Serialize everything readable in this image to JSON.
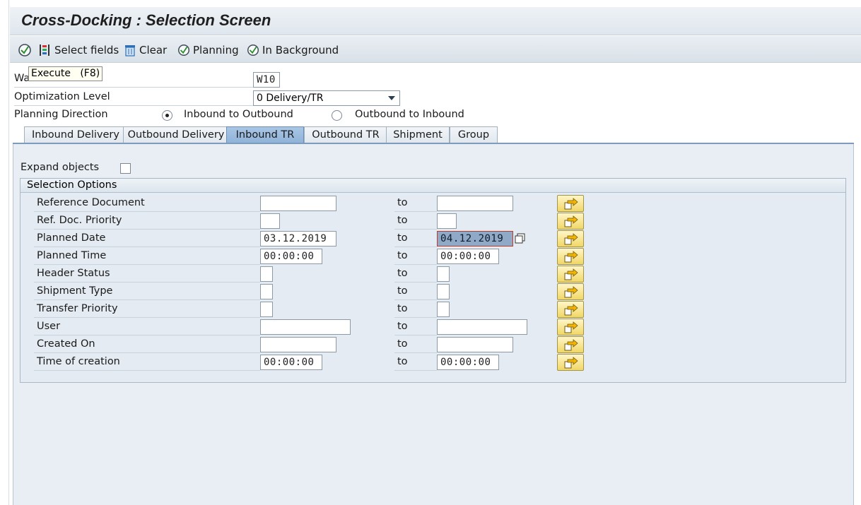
{
  "window": {
    "title": "Cross-Docking : Selection Screen"
  },
  "toolbar": {
    "select_fields": "Select fields",
    "clear": "Clear",
    "planning": "Planning",
    "in_background": "In Background",
    "tooltip": "Execute   (F8)"
  },
  "header_fields": {
    "warehouse_label": "Warehouse",
    "warehouse_value": "W10",
    "optimization_label": "Optimization Level",
    "optimization_value": "0 Delivery/TR",
    "direction_label": "Planning Direction",
    "direction_options": [
      "Inbound to Outbound",
      "Outbound to Inbound"
    ],
    "direction_selected": "Inbound to Outbound"
  },
  "tabs": [
    {
      "label": "Inbound Delivery",
      "active": false
    },
    {
      "label": "Outbound Delivery",
      "active": false
    },
    {
      "label": "Inbound TR",
      "active": true
    },
    {
      "label": "Outbound TR",
      "active": false
    },
    {
      "label": "Shipment",
      "active": false
    },
    {
      "label": "Group",
      "active": false
    }
  ],
  "panel": {
    "expand_objects_label": "Expand objects",
    "expand_objects_checked": false,
    "group_title": "Selection Options",
    "to_label": "to",
    "rows": [
      {
        "label": "Reference Document",
        "from": "",
        "to": ""
      },
      {
        "label": "Ref. Doc. Priority",
        "from": "",
        "to": ""
      },
      {
        "label": "Planned Date",
        "from": "03.12.2019",
        "to": "04.12.2019"
      },
      {
        "label": "Planned Time",
        "from": "00:00:00",
        "to": "00:00:00"
      },
      {
        "label": "Header Status",
        "from": "",
        "to": ""
      },
      {
        "label": "Shipment Type",
        "from": "",
        "to": ""
      },
      {
        "label": "Transfer Priority",
        "from": "",
        "to": ""
      },
      {
        "label": "User",
        "from": "",
        "to": ""
      },
      {
        "label": "Created On",
        "from": "",
        "to": ""
      },
      {
        "label": "Time of creation",
        "from": "00:00:00",
        "to": "00:00:00"
      }
    ]
  },
  "icons": {
    "execute": "execute-icon",
    "select_fields": "select-fields-icon",
    "clear": "trash-icon",
    "planning": "execute-icon",
    "background": "execute-icon",
    "multiple_selection": "multiple-selection-arrow-icon",
    "copy": "copy-icon"
  },
  "colors": {
    "active_tab": "#9dbddf",
    "panel_bg": "#e8eef4",
    "arrow_button": "#f1d766"
  }
}
